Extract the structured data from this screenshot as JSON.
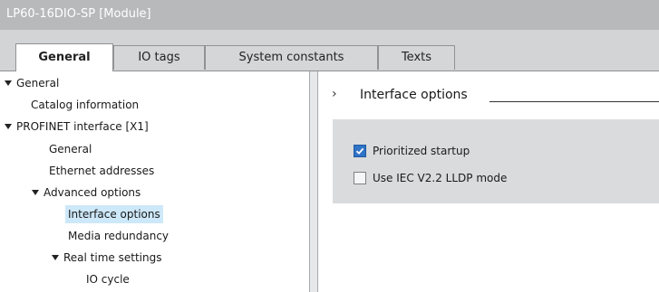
{
  "window": {
    "title": "LP60-16DIO-SP [Module]"
  },
  "tabs": [
    {
      "label": "General"
    },
    {
      "label": "IO tags"
    },
    {
      "label": "System constants"
    },
    {
      "label": "Texts"
    }
  ],
  "tree": {
    "items": [
      {
        "label": "General"
      },
      {
        "label": "Catalog information"
      },
      {
        "label": "PROFINET interface [X1]"
      },
      {
        "label": "General"
      },
      {
        "label": "Ethernet addresses"
      },
      {
        "label": "Advanced options"
      },
      {
        "label": "Interface options"
      },
      {
        "label": "Media redundancy"
      },
      {
        "label": "Real time settings"
      },
      {
        "label": "IO cycle"
      }
    ],
    "selected": "Interface options"
  },
  "content": {
    "section_title": "Interface options",
    "options": [
      {
        "label": "Prioritized startup",
        "checked": true
      },
      {
        "label": "Use IEC V2.2 LLDP mode",
        "checked": false
      }
    ]
  },
  "colors": {
    "title_bar": "#b7b9bb",
    "tab_bar": "#d2d4d6",
    "selection": "#cde8f8",
    "option_panel": "#dadbdc",
    "checkbox_checked": "#2f73c6"
  }
}
